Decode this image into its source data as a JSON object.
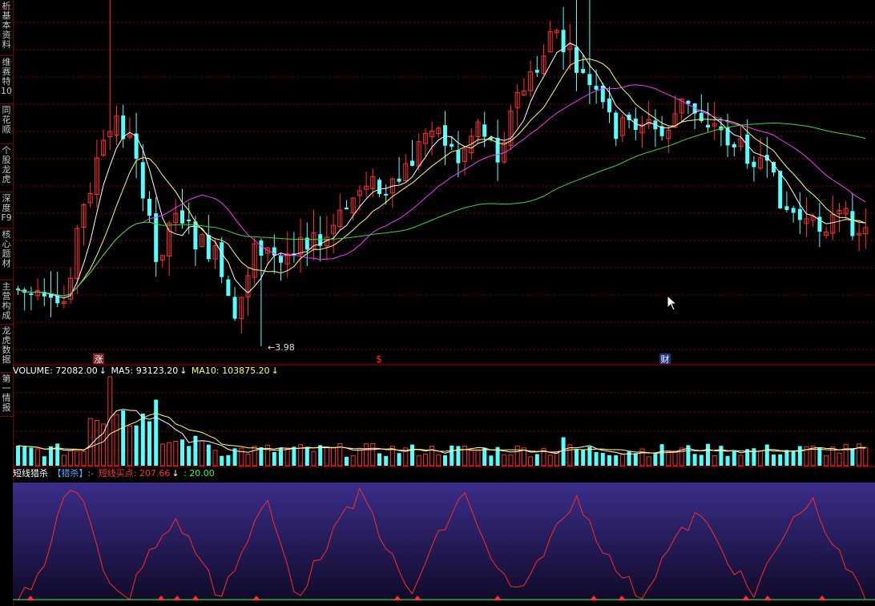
{
  "sidebar": {
    "tabs": [
      {
        "label": "析"
      },
      {
        "label": "基本资料"
      },
      {
        "label": "维赛特10"
      },
      {
        "label": "同花顺"
      },
      {
        "label": "个股龙虎"
      },
      {
        "label": "深度F9"
      },
      {
        "label": "核心题材"
      },
      {
        "label": "主营构成"
      },
      {
        "label": "龙虎数据"
      },
      {
        "label": "第一情报"
      }
    ]
  },
  "colors": {
    "up": "#ff3030",
    "down": "#54ffff",
    "ma_white": "#ffffff",
    "ma_yellow": "#ffff66",
    "ma_magenta": "#ff33ff",
    "ma_green": "#33dd33",
    "grid": "#8b0000",
    "indicator_bg_top": "#3a2e8a",
    "indicator_bg_bottom": "#100a28"
  },
  "markers": {
    "zhang": "涨",
    "dollar": "$",
    "cai": "财",
    "low_label": "3.98"
  },
  "volume_legend": {
    "volume_label": "VOLUME: 72082.00",
    "ma5_label": "MA5: 93123.20",
    "ma10_label": "MA10: 103875.20",
    "arrow": "↓"
  },
  "indicator_legend": {
    "name": "短线猎杀",
    "bracket": "【猎杀】:-",
    "buy_label": "短线买点: 207.66",
    "arrow": "↓",
    "level_label": ": 20.00"
  },
  "chart_data": {
    "type": "candlestick",
    "price_low_label": 3.98,
    "seed": 7
  }
}
